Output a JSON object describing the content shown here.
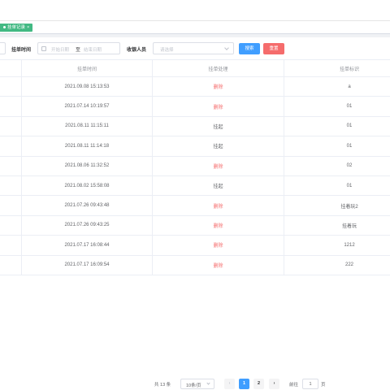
{
  "tags": {
    "active_tab": "挂单记录",
    "close_glyph": "×"
  },
  "search": {
    "time_label": "挂单时间",
    "start_placeholder": "开始日期",
    "range_sep": "至",
    "end_placeholder": "结束日期",
    "receiver_label": "收银人员",
    "receiver_placeholder": "请选择",
    "search_button": "搜索",
    "reset_button": "重置"
  },
  "table": {
    "columns": [
      "",
      "挂单时间",
      "挂单处理",
      "挂单标识"
    ],
    "rows": [
      {
        "time": "2021.09.08 15:13:53",
        "action": "删除",
        "flag": "a"
      },
      {
        "time": "2021.07.14 10:19:57",
        "action": "删除",
        "flag": "01"
      },
      {
        "time": "2021.08.11 11:15:11",
        "action": "挂起",
        "flag": "01"
      },
      {
        "time": "2021.08.11 11:14:18",
        "action": "挂起",
        "flag": "01"
      },
      {
        "time": "2021.08.06 11:32:52",
        "action": "删除",
        "flag": "02"
      },
      {
        "time": "2021.08.02 15:58:08",
        "action": "挂起",
        "flag": "01"
      },
      {
        "time": "2021.07.26 09:43:48",
        "action": "删除",
        "flag": "挂着玩2"
      },
      {
        "time": "2021.07.26 09:43:25",
        "action": "删除",
        "flag": "挂着玩"
      },
      {
        "time": "2021.07.17 16:08:44",
        "action": "删除",
        "flag": "1212"
      },
      {
        "time": "2021.07.17 16:09:54",
        "action": "删除",
        "flag": "222"
      }
    ]
  },
  "pagination": {
    "total": "共 13 条",
    "page_size": "10条/页",
    "prev": "‹",
    "pages": [
      "1",
      "2"
    ],
    "current_page": "1",
    "next": "›",
    "goto_label": "前往",
    "goto_value": "1",
    "page_unit": "页"
  },
  "colors": {
    "accent": "#409eff",
    "danger": "#f56c6c",
    "tag": "#42b983"
  }
}
